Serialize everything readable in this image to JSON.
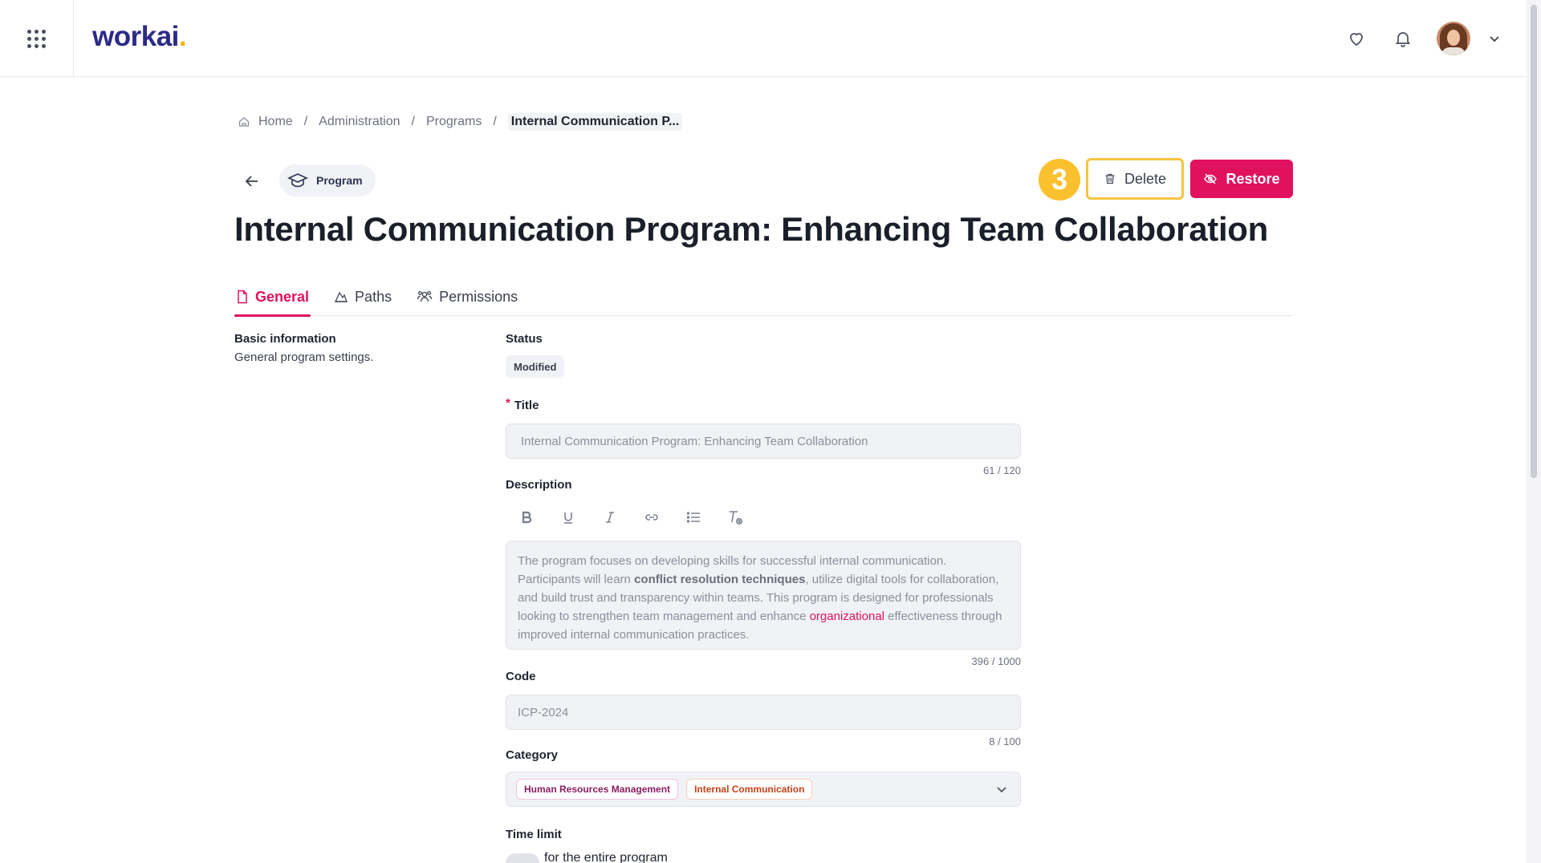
{
  "topbar": {
    "logo_text": "workai",
    "logo_dot": ".",
    "icons": [
      "apps-grid-icon",
      "heart-icon",
      "bell-icon",
      "chevron-down-icon"
    ]
  },
  "breadcrumb": {
    "items": [
      "Home",
      "Administration",
      "Programs"
    ],
    "current": "Internal Communication P...",
    "separator": "/"
  },
  "header": {
    "type_badge": "Program",
    "step_marker": "3",
    "delete_label": "Delete",
    "restore_label": "Restore",
    "title": "Internal Communication Program: Enhancing Team Collaboration"
  },
  "tabs": [
    {
      "label": "General",
      "active": true
    },
    {
      "label": "Paths",
      "active": false
    },
    {
      "label": "Permissions",
      "active": false
    }
  ],
  "section": {
    "title": "Basic information",
    "description": "General program settings."
  },
  "form": {
    "status_label": "Status",
    "status_value": "Modified",
    "required_marker": "*",
    "title_label": "Title",
    "title_value": "Internal Communication Program: Enhancing Team Collaboration",
    "title_counter": "61 / 120",
    "description_label": "Description",
    "description_parts": {
      "p1": "The program focuses on developing skills for successful internal communication. Participants will learn ",
      "bold": "conflict resolution techniques",
      "p2": ", utilize digital tools for collaboration, and build trust and transparency within teams. This program is designed for professionals looking to strengthen team management and enhance ",
      "link": "organizational",
      "p3": " effectiveness through improved internal communication practices."
    },
    "description_counter": "396 / 1000",
    "code_label": "Code",
    "code_value": "ICP-2024",
    "code_counter": "8 / 100",
    "category_label": "Category",
    "categories": [
      "Human Resources Management",
      "Internal Communication"
    ],
    "time_limit_label": "Time limit",
    "time_limit_option": "for the entire program"
  },
  "colors": {
    "accent": "#e0115f",
    "brand": "#2c2a86",
    "highlight": "#fbc02d"
  }
}
